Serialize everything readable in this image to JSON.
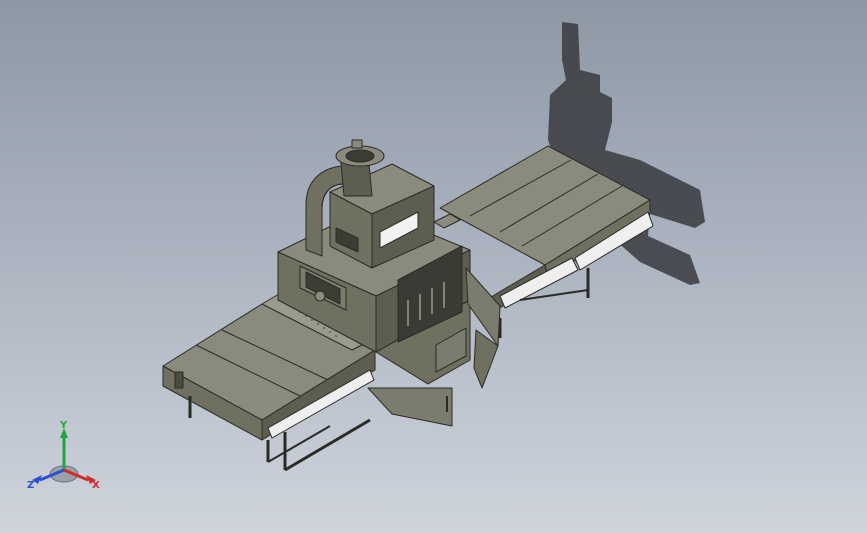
{
  "viewport": {
    "background_top": "#8e97a4",
    "background_bottom": "#cfd4dc",
    "model": "uv-curing-conveyor-machine"
  },
  "triad": {
    "x_label": "X",
    "y_label": "Y",
    "z_label": "Z",
    "x_color": "#d22a2a",
    "y_color": "#1fa83a",
    "z_color": "#2a4fd2"
  },
  "colors": {
    "body_top": "#8a8b7d",
    "body_left": "#6f705f",
    "body_right": "#5d5e50",
    "edge": "#2b2b26",
    "shadow": "#3a3d40",
    "glass": "#f2f2f2"
  }
}
